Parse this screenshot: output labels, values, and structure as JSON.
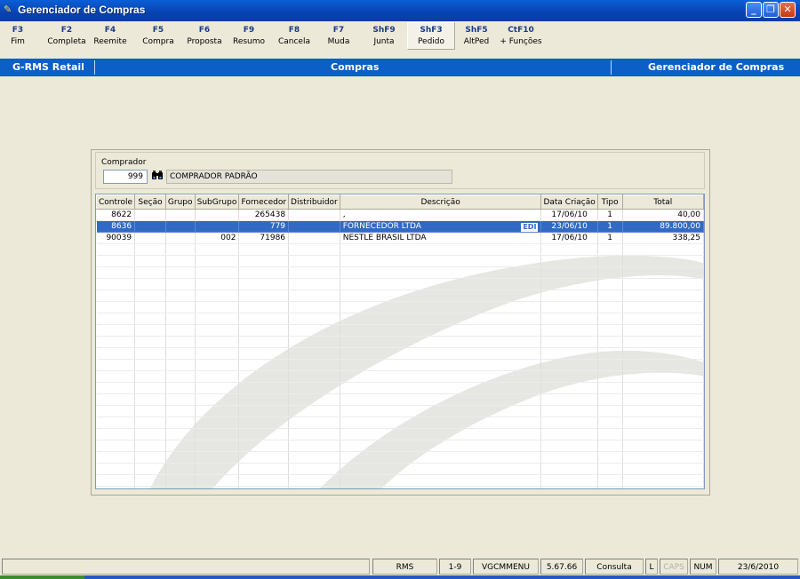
{
  "window": {
    "title": "Gerenciador de Compras"
  },
  "fkeys": [
    {
      "key": "F3",
      "label": "Fim"
    },
    {
      "key": "F2",
      "label": "Completa"
    },
    {
      "key": "F4",
      "label": "Reemite"
    },
    {
      "key": "F5",
      "label": "Compra"
    },
    {
      "key": "F6",
      "label": "Proposta"
    },
    {
      "key": "F9",
      "label": "Resumo"
    },
    {
      "key": "F8",
      "label": "Cancela"
    },
    {
      "key": "F7",
      "label": "Muda"
    },
    {
      "key": "ShF9",
      "label": "Junta"
    },
    {
      "key": "ShF3",
      "label": "Pedido"
    },
    {
      "key": "ShF5",
      "label": "AltPed"
    },
    {
      "key": "CtF10",
      "label": "+ Funções"
    }
  ],
  "header": {
    "system": "G-RMS Retail",
    "module": "Compras",
    "screen": "Gerenciador de Compras"
  },
  "buyer": {
    "label": "Comprador",
    "code": "999",
    "name": "COMPRADOR PADRÃO"
  },
  "grid": {
    "columns": [
      "Controle",
      "Seção",
      "Grupo",
      "SubGrupo",
      "Fornecedor",
      "Distribuidor",
      "Descrição",
      "Data Criação",
      "Tipo",
      "Total"
    ],
    "rows": [
      {
        "controle": "8622",
        "secao": "",
        "grupo": "",
        "subgrupo": "",
        "fornecedor": "265438",
        "distribuidor": "",
        "descricao": ",",
        "edi": "",
        "data": "17/06/10",
        "tipo": "1",
        "total": "40,00"
      },
      {
        "controle": "8636",
        "secao": "",
        "grupo": "",
        "subgrupo": "",
        "fornecedor": "779",
        "distribuidor": "",
        "descricao": "FORNECEDOR LTDA",
        "edi": "EDI",
        "data": "23/06/10",
        "tipo": "1",
        "total": "89.800,00"
      },
      {
        "controle": "90039",
        "secao": "",
        "grupo": "",
        "subgrupo": "002",
        "fornecedor": "71986",
        "distribuidor": "",
        "descricao": "NESTLE BRASIL LTDA",
        "edi": "",
        "data": "17/06/10",
        "tipo": "1",
        "total": "338,25"
      }
    ],
    "selected_row": 1
  },
  "status": {
    "message": "",
    "app": "RMS",
    "range": "1-9",
    "program": "VGCMMENU",
    "version": "5.67.66",
    "mode": "Consulta",
    "l": "L",
    "caps": "CAPS",
    "num": "NUM",
    "date": "23/6/2010"
  },
  "colors": {
    "title_bar": "#0842b0",
    "header_bar": "#0c5fc6",
    "selection": "#316ac5",
    "key_text": "#1a3a8a"
  }
}
